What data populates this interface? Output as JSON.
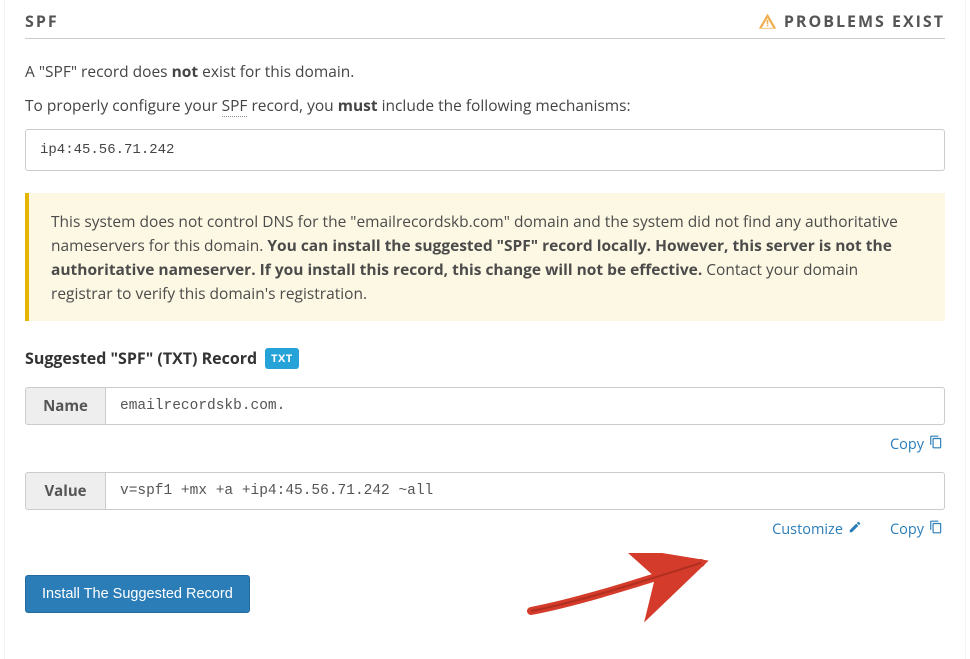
{
  "header": {
    "title": "SPF",
    "status_text": "PROBLEMS EXIST"
  },
  "intro": {
    "line1_a": "A \"SPF\" record does ",
    "line1_bold": "not",
    "line1_b": " exist for this domain.",
    "line2_a": "To properly configure your ",
    "line2_abbr": "SPF",
    "line2_b": " record, you ",
    "line2_bold": "must",
    "line2_c": " include the following mechanisms:"
  },
  "mechanisms": "ip4:45.56.71.242",
  "alert": {
    "part1": "This system does not control DNS for the \"emailrecordskb.com\" domain and the system did not find any authoritative nameservers for this domain. ",
    "bold": "You can install the suggested \"SPF\" record locally. However, this server is not the authoritative nameserver. If you install this record, this change will not be effective.",
    "part2": " Contact your domain registrar to verify this domain's registration."
  },
  "suggested": {
    "label": "Suggested \"SPF\" (TXT) Record",
    "badge": "TXT"
  },
  "fields": {
    "name_label": "Name",
    "name_value": "emailrecordskb.com.",
    "value_label": "Value",
    "value_value": "v=spf1 +mx +a +ip4:45.56.71.242 ~all"
  },
  "actions": {
    "copy": "Copy",
    "customize": "Customize"
  },
  "install_button": "Install The Suggested Record"
}
